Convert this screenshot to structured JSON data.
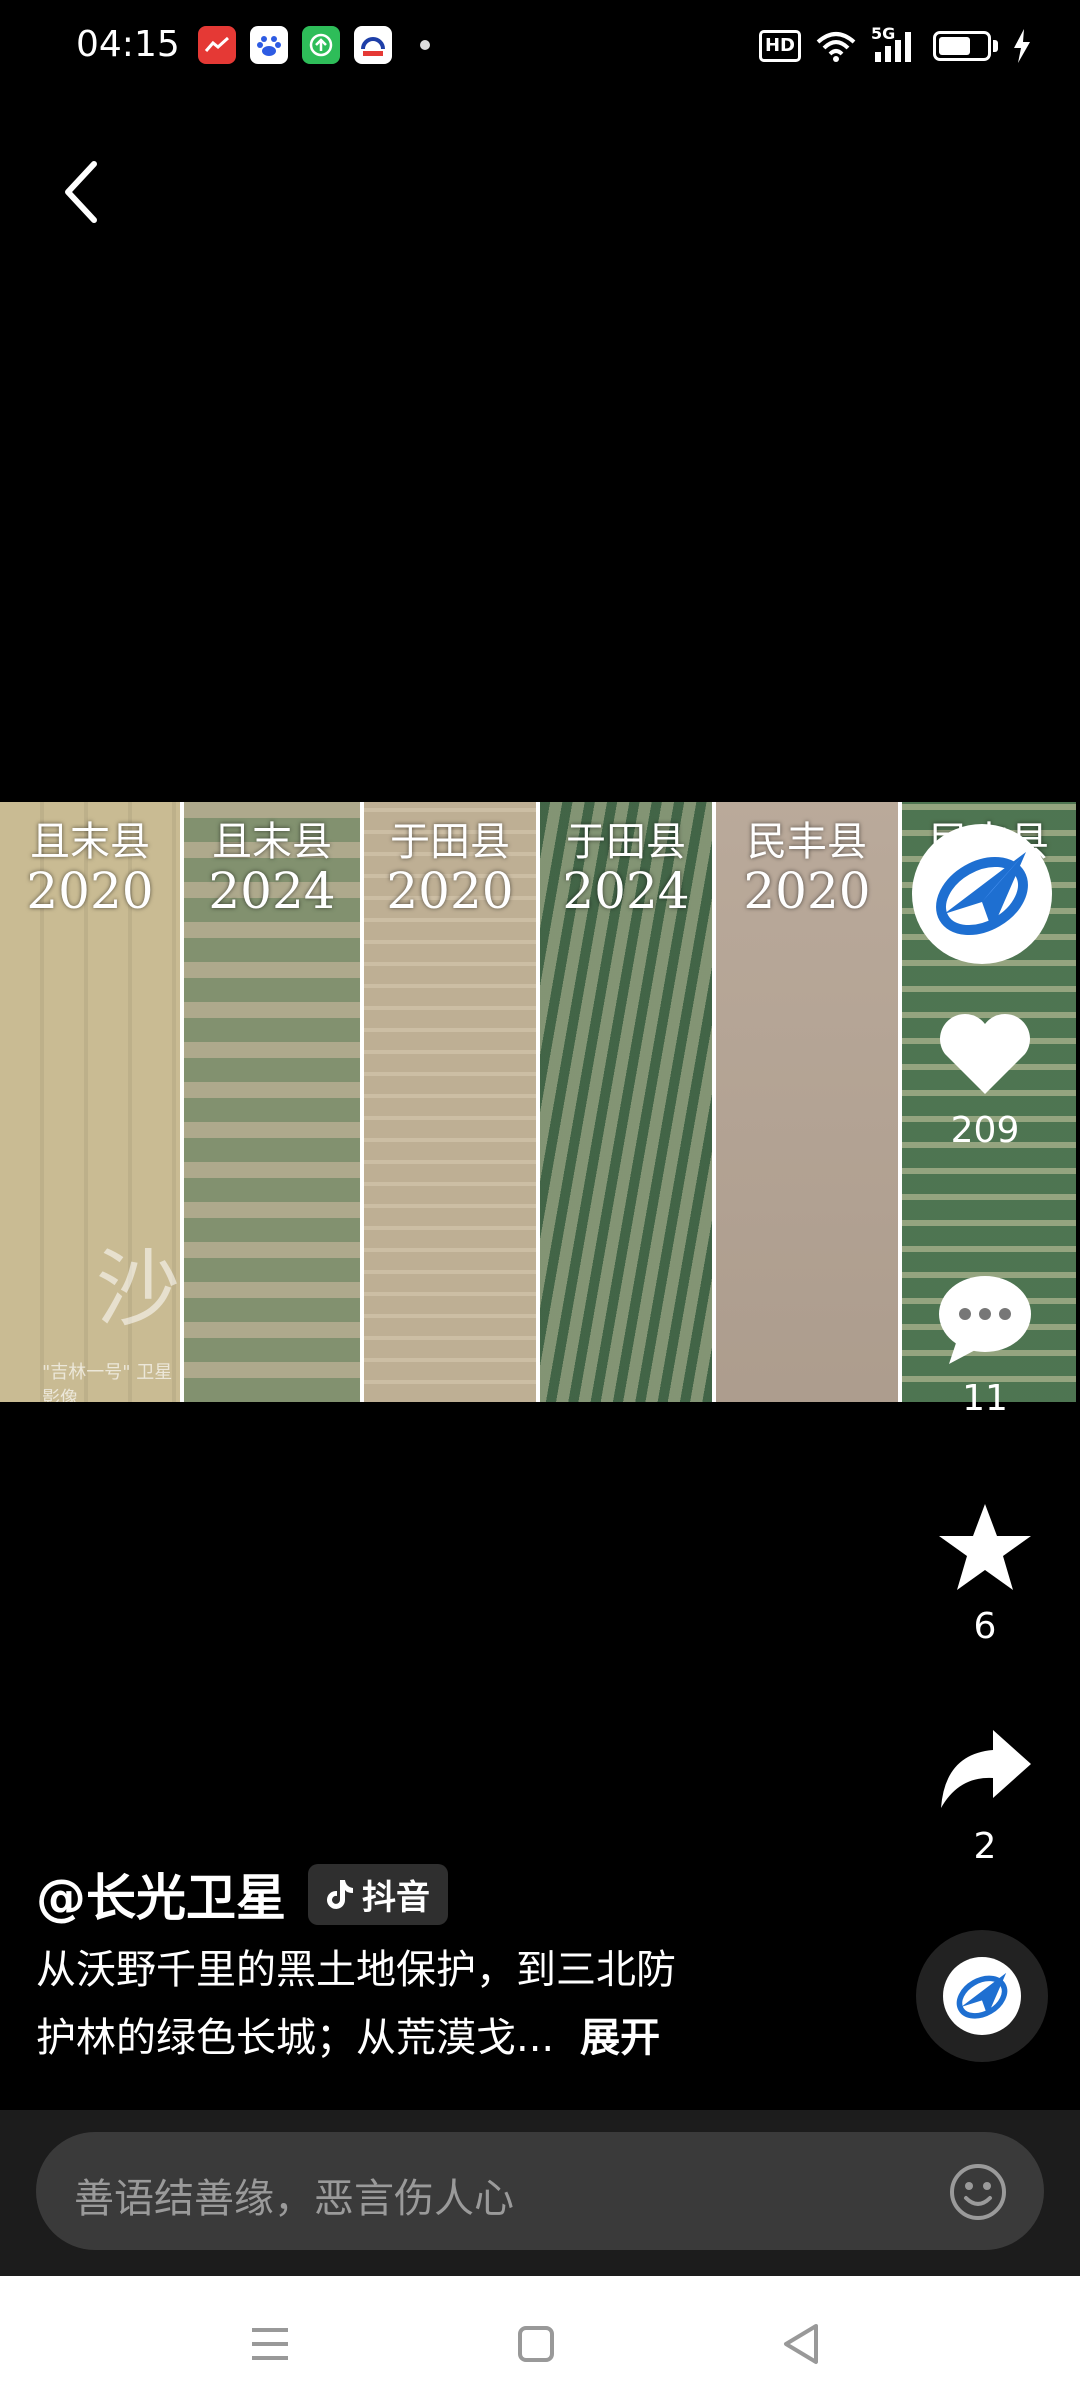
{
  "status_bar": {
    "time": "04:15",
    "apps": [
      {
        "icon": "red-app-icon",
        "color": "#e53935",
        "text": ""
      },
      {
        "icon": "baidu-app-icon",
        "color": "#ffffff",
        "text": ""
      },
      {
        "icon": "green-upload-app-icon",
        "color": "#2ebd59",
        "text": ""
      },
      {
        "icon": "blue-app-icon",
        "color": "#ffffff",
        "text": ""
      }
    ],
    "hd": "HD",
    "network": "5G"
  },
  "video": {
    "panels": [
      {
        "county": "且末县",
        "year": "2020",
        "color": "#c9bb93"
      },
      {
        "county": "且末县",
        "year": "2024",
        "color": "#a7a48a"
      },
      {
        "county": "于田县",
        "year": "2020",
        "color": "#c8b89c"
      },
      {
        "county": "于田县",
        "year": "2024",
        "color": "#6f8a6c"
      },
      {
        "county": "民丰县",
        "year": "2020",
        "color": "#b6a595"
      },
      {
        "county": "民丰县",
        "year": "",
        "color": "#6e8b63"
      }
    ],
    "watermark_char": "沙",
    "watermark_credit": "\"吉林一号\" 卫星影像"
  },
  "rail": {
    "likes": "209",
    "comments": "11",
    "favorites": "6",
    "shares": "2"
  },
  "post": {
    "author": "@长光卫星",
    "platform": "抖音",
    "description_line1": "从沃野千里的黑土地保护，到三北防",
    "description_line2": "护林的绿色长城；从荒漠戈...",
    "expand": "展开"
  },
  "comment_bar": {
    "placeholder": "善语结善缘，恶言伤人心"
  },
  "colors": {
    "accent_blue": "#1e6fd1",
    "background": "#000000"
  }
}
